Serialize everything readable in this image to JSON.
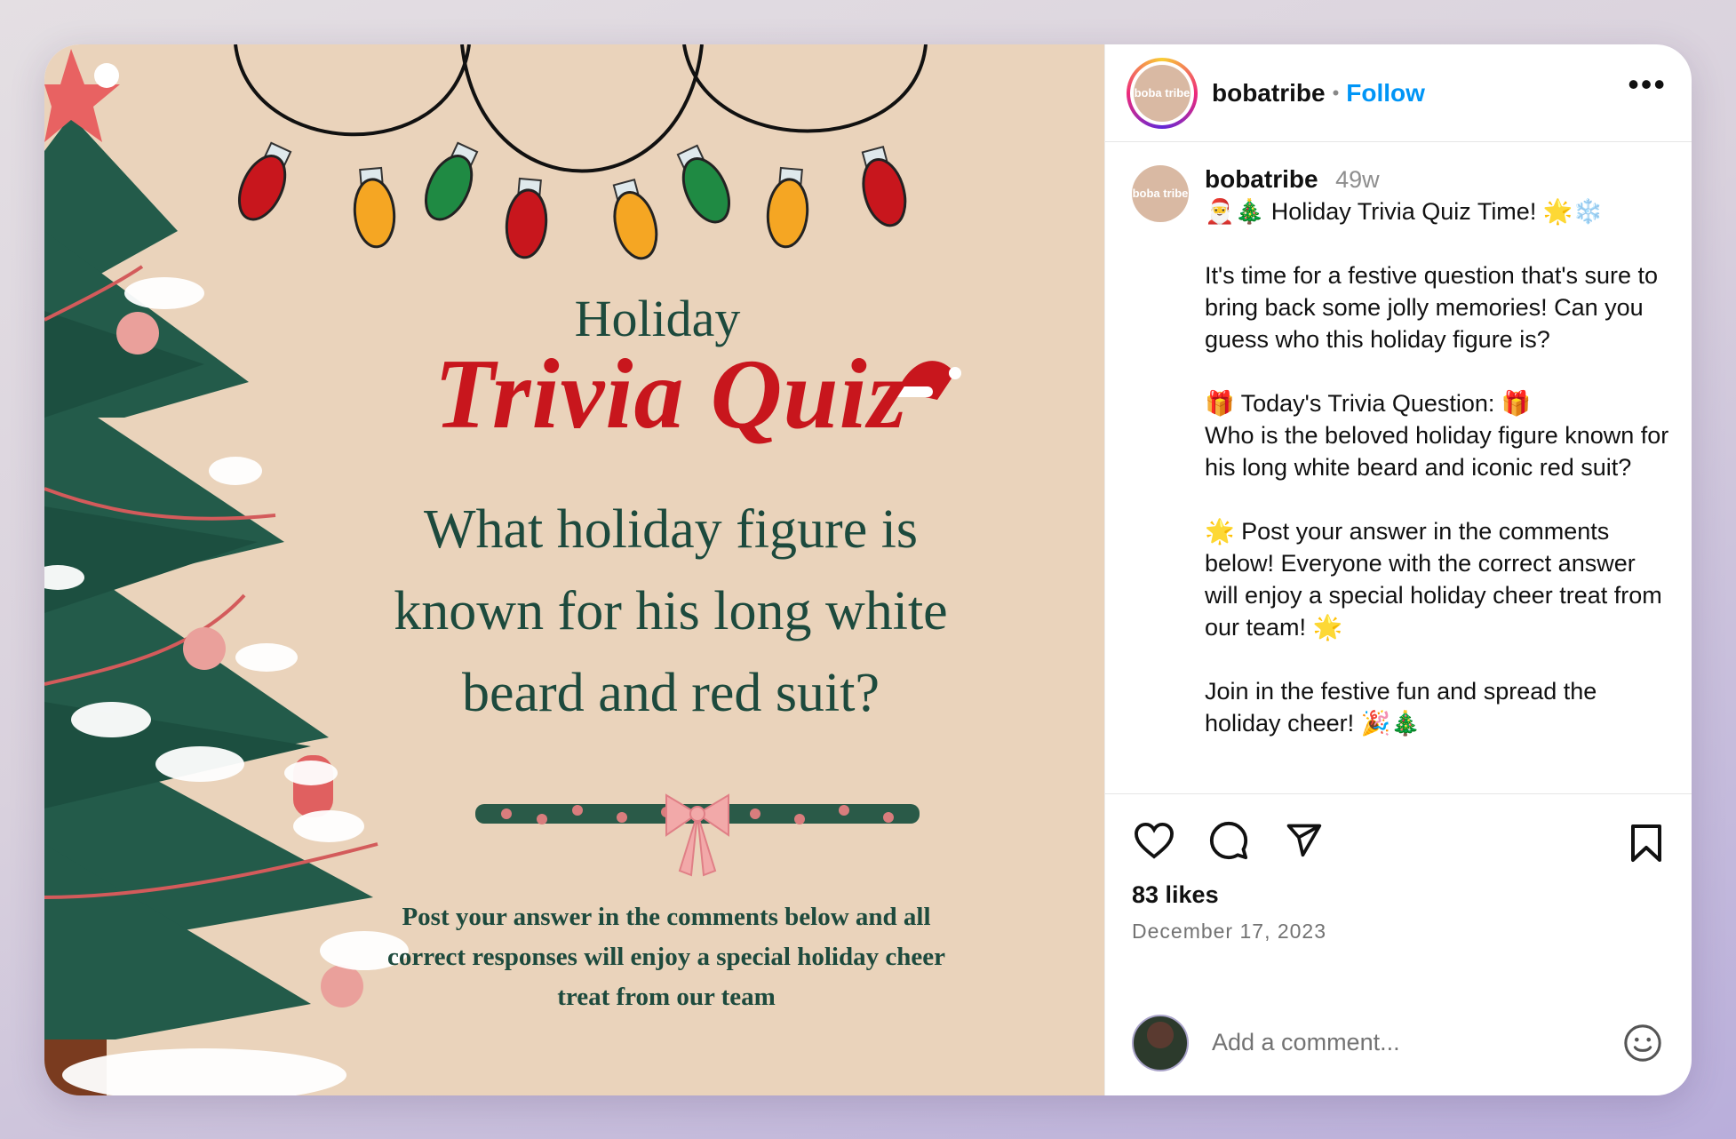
{
  "post_image": {
    "heading_small": "Holiday",
    "heading_big": "Trivia Quiz",
    "question": "What holiday figure is known for his long white beard and red suit?",
    "footer": "Post your answer in the comments below and all correct responses will enjoy a special holiday cheer treat from our team"
  },
  "header": {
    "avatar_text": "boba tribe",
    "username": "bobatribe",
    "separator": "•",
    "follow_label": "Follow",
    "more_label": "•••"
  },
  "caption": {
    "username": "bobatribe",
    "time": "49w",
    "paragraphs": [
      "🎅🎄 Holiday Trivia Quiz Time! 🌟❄️",
      "It's time for a festive question that's sure to bring back some jolly memories! Can you guess who this holiday figure is?",
      "🎁 Today's Trivia Question: 🎁\nWho is the beloved holiday figure known for his long white beard and iconic red suit?",
      "🌟 Post your answer in the comments below! Everyone with the correct answer will enjoy a special holiday cheer treat from our team! 🌟",
      "Join in the festive fun and spread the holiday cheer! 🎉🎄"
    ]
  },
  "actions": {
    "likes": "83 likes",
    "date": "December 17, 2023",
    "icons": [
      "heart-icon",
      "comment-icon",
      "share-icon",
      "bookmark-icon"
    ]
  },
  "comment": {
    "placeholder": "Add a comment...",
    "emoji_icon": "smiley-icon"
  },
  "colors": {
    "follow": "#0095f6",
    "image_bg": "#ead3bb",
    "title_red": "#c8161d",
    "title_green": "#1d4a3d"
  }
}
